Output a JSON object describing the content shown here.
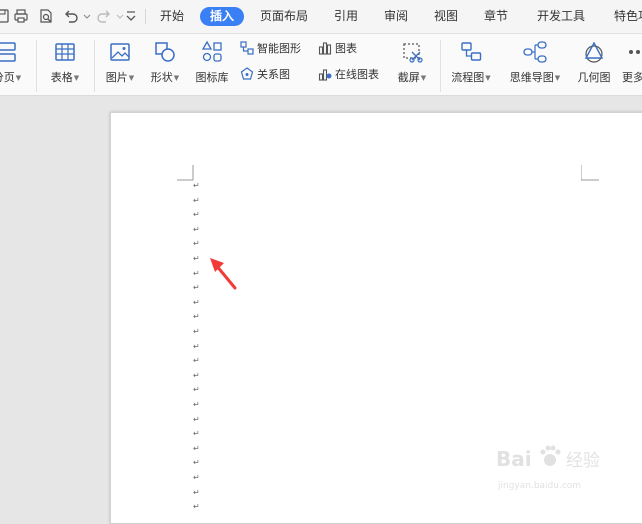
{
  "menubar": {
    "tabs": [
      {
        "label": "开始"
      },
      {
        "label": "插入",
        "active": true
      },
      {
        "label": "页面布局"
      },
      {
        "label": "引用"
      },
      {
        "label": "审阅"
      },
      {
        "label": "视图"
      },
      {
        "label": "章节"
      },
      {
        "label": "开发工具"
      },
      {
        "label": "特色功能"
      }
    ]
  },
  "ribbon": {
    "pagebreak_label": "分页",
    "table_label": "表格",
    "picture_label": "图片",
    "shape_label": "形状",
    "iconlib_label": "图标库",
    "smartart_label": "智能图形",
    "relation_label": "关系图",
    "chart_label": "图表",
    "onlinechart_label": "在线图表",
    "screenshot_label": "截屏",
    "flowchart_label": "流程图",
    "mindmap_label": "思维导图",
    "geometry_label": "几何图",
    "more_label": "更多"
  },
  "document": {
    "paragraph_mark": "↵",
    "paragraph_mark_count": 23
  },
  "watermark": {
    "brand": "Bai",
    "brand_cn": "经验",
    "url": "jingyan.baidu.com"
  },
  "colors": {
    "accent": "#3a7ff3",
    "icon_blue": "#3a6fc4",
    "arrow_red": "#f23b36"
  }
}
